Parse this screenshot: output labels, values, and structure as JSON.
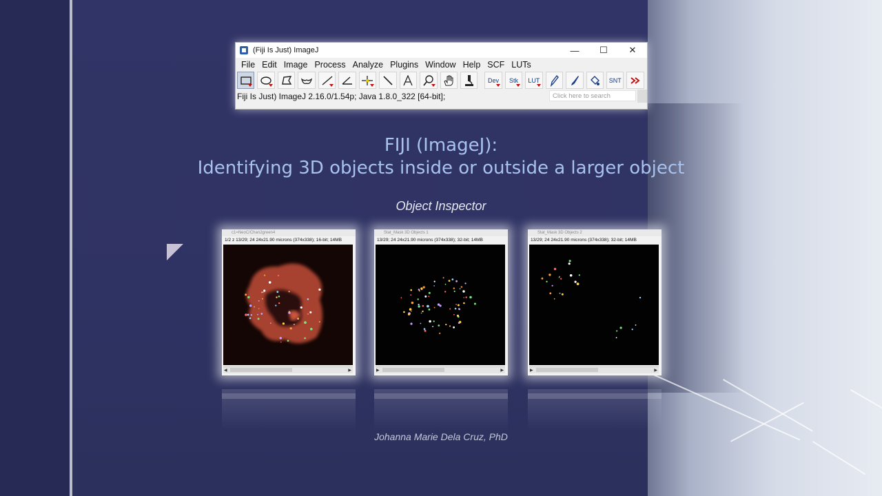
{
  "window": {
    "title": "(Fiji Is Just) ImageJ",
    "controls": {
      "minimize": "—",
      "maximize": "☐",
      "close": "✕"
    },
    "menu": [
      "File",
      "Edit",
      "Image",
      "Process",
      "Analyze",
      "Plugins",
      "Window",
      "Help",
      "SCF",
      "LUTs"
    ],
    "tools": {
      "dev": "Dev",
      "stk": "Stk",
      "lut": "LUT",
      "snt": "SNT"
    },
    "status": "Fiji Is Just) ImageJ 2.16.0/1.54p; Java 1.8.0_322 [64-bit];",
    "search_placeholder": "Click here to search"
  },
  "slide": {
    "title_line1": "FIJI (ImageJ):",
    "title_line2": "Identifying 3D objects inside or outside a larger object",
    "subtitle": "Object Inspector",
    "author": "Johanna Marie Dela Cruz, PhD"
  },
  "image_windows": [
    {
      "title": "c1=NeoC/Chan2green4",
      "info": "1/2 z 13/29; 24 24x21.90 microns (374x338); 16-bit; 14MB"
    },
    {
      "title": "Stat_Mask 3D Objects 1",
      "info": "13/29; 24 24x21.90 microns (374x338); 32-bit; 14MB"
    },
    {
      "title": "Stat_Mask 3D Objects 2",
      "info": "13/29; 24 24x21.90 microns (374x338); 32-bit; 14MB"
    }
  ],
  "colors": {
    "title_text": "#a9c3ee",
    "slide_bg": "#2f3363",
    "tool_arrow": "#c01010"
  }
}
